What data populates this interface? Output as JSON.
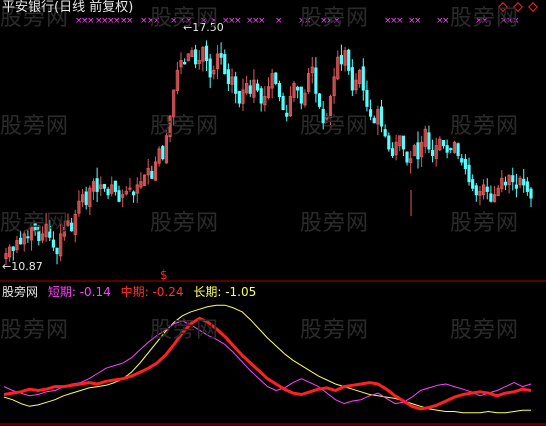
{
  "title": "平安银行(日线 前复权)",
  "max_label": "17.50",
  "min_label": "10.87",
  "dollar_marker": "$",
  "watermark_text": "股旁网",
  "indicator": {
    "name": "股旁网",
    "labels": [
      {
        "text": "短期: -0.14",
        "color": "#ff40ff"
      },
      {
        "text": "中期: -0.24",
        "color": "#ff3030"
      },
      {
        "text": "长期: -1.05",
        "color": "#ffff60"
      }
    ]
  },
  "colors": {
    "up": "#e0585a",
    "down": "#55ffff",
    "axis": "#b00000",
    "marker": "#ff40ff",
    "short": "#ff40ff",
    "mid": "#ff2020",
    "long": "#ffff60",
    "diamond": "#ff2020"
  },
  "chart_data": [
    {
      "type": "candlestick",
      "title": "平安银行(日线 前复权)",
      "annotations": [
        "17.50",
        "10.87"
      ],
      "ylim": [
        10.5,
        18.2
      ],
      "close": [
        11.0,
        11.2,
        11.1,
        11.4,
        11.3,
        11.6,
        11.5,
        11.8,
        11.7,
        11.4,
        11.6,
        11.9,
        11.5,
        11.2,
        11.0,
        11.6,
        11.8,
        12.0,
        11.7,
        12.2,
        12.6,
        12.8,
        12.5,
        13.0,
        13.2,
        12.9,
        13.1,
        13.0,
        12.8,
        13.1,
        12.9,
        12.6,
        12.8,
        12.9,
        13.0,
        12.8,
        13.1,
        13.2,
        13.4,
        13.6,
        13.3,
        13.8,
        14.2,
        13.9,
        14.6,
        15.2,
        16.0,
        16.6,
        16.9,
        16.8,
        17.1,
        17.2,
        16.8,
        16.9,
        17.3,
        16.9,
        16.4,
        16.6,
        17.1,
        17.0,
        16.5,
        16.2,
        16.4,
        15.9,
        15.6,
        16.0,
        16.2,
        15.9,
        16.3,
        16.0,
        15.6,
        15.8,
        16.1,
        16.5,
        16.2,
        15.8,
        15.4,
        15.2,
        15.8,
        16.2,
        16.0,
        15.6,
        15.9,
        16.5,
        16.7,
        15.9,
        15.5,
        15.0,
        15.2,
        15.8,
        16.4,
        17.0,
        16.8,
        17.2,
        16.6,
        16.0,
        16.3,
        16.6,
        16.0,
        15.5,
        15.2,
        15.0,
        15.4,
        14.9,
        14.6,
        14.2,
        14.0,
        14.4,
        14.6,
        14.2,
        13.8,
        13.9,
        14.3,
        13.9,
        14.4,
        14.8,
        14.2,
        14.0,
        14.3,
        14.5,
        14.3,
        14.1,
        14.2,
        14.4,
        14.0,
        13.8,
        13.6,
        13.2,
        13.0,
        12.8,
        12.9,
        13.1,
        12.9,
        12.6,
        12.8,
        13.0,
        13.3,
        13.1,
        13.4,
        13.2,
        13.0,
        13.3,
        13.1,
        12.9,
        12.7
      ]
    },
    {
      "type": "line",
      "series": [
        {
          "name": "短期",
          "values": [
            -1.6,
            -1.9,
            -2.1,
            -2.3,
            -2.2,
            -2.0,
            -1.9,
            -1.6,
            -1.4,
            -1.3,
            -1.0,
            -0.6,
            -0.2,
            0.0,
            0.2,
            0.6,
            1.2,
            1.8,
            2.3,
            2.7,
            3.2,
            3.4,
            3.1,
            2.7,
            2.3,
            2.0,
            1.6,
            1.0,
            0.3,
            -0.4,
            -1.0,
            -1.6,
            -1.9,
            -1.7,
            -1.3,
            -1.0,
            -1.3,
            -1.6,
            -2.1,
            -2.6,
            -2.9,
            -2.7,
            -2.6,
            -2.3,
            -2.1,
            -2.5,
            -2.9,
            -2.8,
            -2.4,
            -1.9,
            -1.7,
            -1.5,
            -1.4,
            -1.6,
            -1.8,
            -2.0,
            -2.3,
            -2.1,
            -1.9,
            -1.6,
            -1.3,
            -1.6,
            -1.4
          ]
        },
        {
          "name": "中期",
          "values": [
            -2.2,
            -2.1,
            -2.0,
            -1.8,
            -1.9,
            -1.8,
            -1.6,
            -1.6,
            -1.5,
            -1.4,
            -1.3,
            -1.4,
            -1.2,
            -1.1,
            -1.0,
            -0.8,
            -0.5,
            -0.2,
            0.2,
            0.8,
            1.6,
            2.5,
            3.2,
            3.6,
            3.3,
            2.8,
            2.2,
            1.5,
            0.8,
            0.2,
            -0.4,
            -1.0,
            -1.4,
            -1.8,
            -2.1,
            -2.2,
            -2.0,
            -1.8,
            -1.7,
            -1.9,
            -1.6,
            -1.5,
            -1.4,
            -1.3,
            -1.4,
            -1.8,
            -2.3,
            -2.7,
            -3.1,
            -3.3,
            -3.2,
            -3.0,
            -2.7,
            -2.4,
            -2.2,
            -2.1,
            -2.0,
            -2.1,
            -2.3,
            -2.1,
            -2.0,
            -1.8,
            -1.9
          ]
        },
        {
          "name": "长期",
          "values": [
            -2.4,
            -2.6,
            -2.9,
            -3.1,
            -3.0,
            -2.8,
            -2.6,
            -2.3,
            -2.1,
            -1.9,
            -1.7,
            -1.6,
            -1.5,
            -1.3,
            -1.0,
            -0.5,
            0.2,
            1.0,
            1.8,
            2.6,
            3.3,
            3.8,
            4.1,
            4.3,
            4.5,
            4.6,
            4.6,
            4.4,
            4.1,
            3.5,
            2.8,
            2.1,
            1.5,
            0.9,
            0.4,
            0.0,
            -0.4,
            -0.8,
            -1.1,
            -1.4,
            -1.6,
            -1.8,
            -2.0,
            -2.2,
            -2.3,
            -2.4,
            -2.5,
            -2.7,
            -2.9,
            -3.1,
            -3.3,
            -3.4,
            -3.5,
            -3.5,
            -3.6,
            -3.6,
            -3.6,
            -3.5,
            -3.6,
            -3.6,
            -3.5,
            -3.4,
            -3.4
          ]
        }
      ],
      "ylim": [
        -4.3,
        5.0
      ]
    }
  ]
}
